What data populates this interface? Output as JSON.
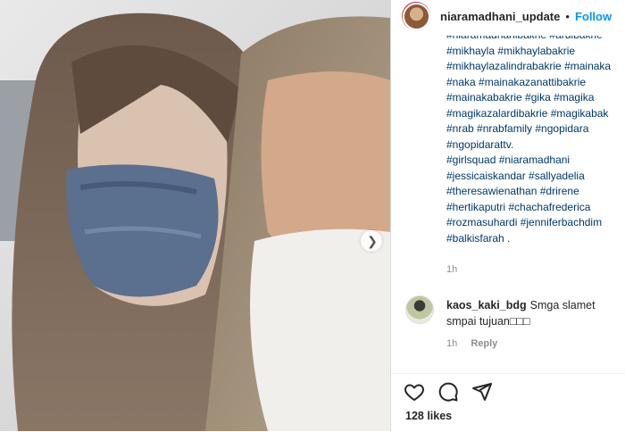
{
  "post": {
    "username": "niaramadhani_update",
    "follow_label": "Follow",
    "caption_lines": [
      "#niaramadhanibakrie #ardibakrie",
      "#mikhayla #mikhaylabakrie",
      "#mikhaylazalindrabakrie #mainaka",
      "#naka #mainakazanattibakrie",
      "#mainakabakrie #gika #magika",
      "#magikazalardibakrie #magikabak",
      "#nrab #nrabfamily #ngopidara",
      "#ngopidarattv.",
      "#girlsquad #niaramadhani",
      "#jessicaiskandar #sallyadelia",
      "#theresawienathan #drirene",
      "#hertikaputri #chachafrederica",
      "#rozmasuhardi #jenniferbachdim",
      "#balkisfarah ."
    ],
    "caption_time": "1h",
    "likes": "128 likes"
  },
  "comment": {
    "username": "kaos_kaki_bdg",
    "text": "Smga slamet smpai tujuan□□□",
    "time": "1h",
    "reply_label": "Reply"
  },
  "icons": {
    "like": "heart-icon",
    "comment": "comment-icon",
    "share": "share-icon",
    "next": "chevron-right-icon"
  },
  "colors": {
    "link": "#0095f6",
    "hashtag": "#00376b",
    "meta": "#8e8e8e"
  }
}
